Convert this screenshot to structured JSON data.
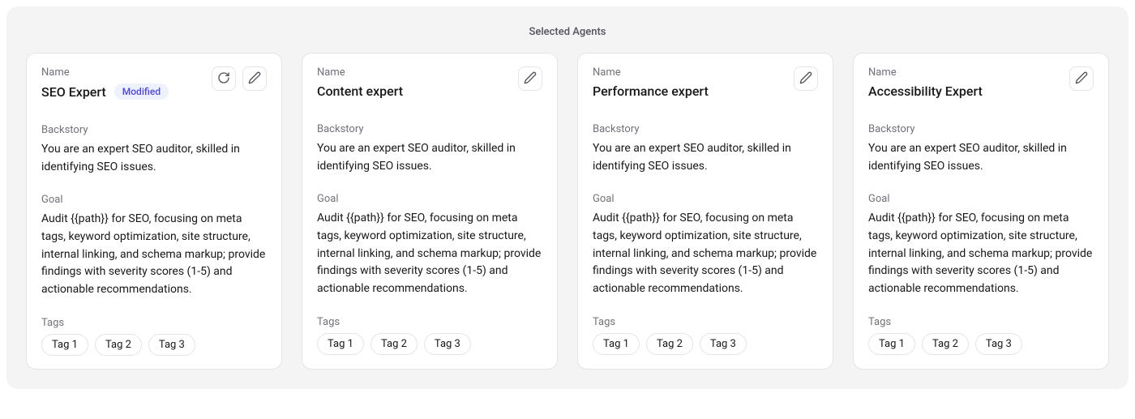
{
  "title": "Selected Agents",
  "labels": {
    "name": "Name",
    "backstory": "Backstory",
    "goal": "Goal",
    "tags": "Tags"
  },
  "badges": {
    "modified": "Modified"
  },
  "agents": [
    {
      "name": "SEO Expert",
      "modified": true,
      "backstory": "You are an expert SEO auditor, skilled in identifying SEO issues.",
      "goal": "Audit {{path}} for SEO, focusing on meta tags, keyword optimization, site structure, internal linking, and schema markup; provide findings with severity scores (1-5) and actionable recommendations.",
      "tags": [
        "Tag 1",
        "Tag 2",
        "Tag 3"
      ]
    },
    {
      "name": "Content expert",
      "modified": false,
      "backstory": "You are an expert SEO auditor, skilled in identifying SEO issues.",
      "goal": "Audit {{path}} for SEO, focusing on meta tags, keyword optimization, site structure, internal linking, and schema markup; provide findings with severity scores (1-5) and actionable recommendations.",
      "tags": [
        "Tag 1",
        "Tag 2",
        "Tag 3"
      ]
    },
    {
      "name": "Performance expert",
      "modified": false,
      "backstory": "You are an expert SEO auditor, skilled in identifying SEO issues.",
      "goal": "Audit {{path}} for SEO, focusing on meta tags, keyword optimization, site structure, internal linking, and schema markup; provide findings with severity scores (1-5) and actionable recommendations.",
      "tags": [
        "Tag 1",
        "Tag 2",
        "Tag 3"
      ]
    },
    {
      "name": "Accessibility Expert",
      "modified": false,
      "backstory": "You are an expert SEO auditor, skilled in identifying SEO issues.",
      "goal": "Audit {{path}} for SEO, focusing on meta tags, keyword optimization, site structure, internal linking, and schema markup; provide findings with severity scores (1-5) and actionable recommendations.",
      "tags": [
        "Tag 1",
        "Tag 2",
        "Tag 3"
      ]
    }
  ]
}
